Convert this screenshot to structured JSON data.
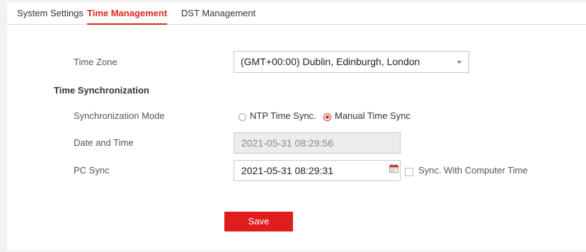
{
  "tabs": [
    {
      "label": "System Settings",
      "active": false
    },
    {
      "label": "Time Management",
      "active": true
    },
    {
      "label": "DST Management",
      "active": false
    }
  ],
  "form": {
    "time_zone": {
      "label": "Time Zone",
      "value": "(GMT+00:00) Dublin, Edinburgh, London"
    },
    "time_sync_section": "Time Synchronization",
    "sync_mode": {
      "label": "Synchronization Mode",
      "options": [
        "NTP Time Sync.",
        "Manual Time Sync"
      ],
      "selected": "Manual Time Sync"
    },
    "date_time": {
      "label": "Date and Time",
      "value": "2021-05-31 08:29:56"
    },
    "pc_sync": {
      "label": "PC Sync",
      "value": "2021-05-31 08:29:31",
      "checkbox_label": "Sync. With Computer Time",
      "checked": false
    },
    "save_label": "Save"
  },
  "colors": {
    "accent": "#e0251f",
    "button": "#e01d1d"
  },
  "icons": {
    "time_zone_dropdown": "chevron-down-icon",
    "pc_sync_picker": "calendar-icon"
  }
}
